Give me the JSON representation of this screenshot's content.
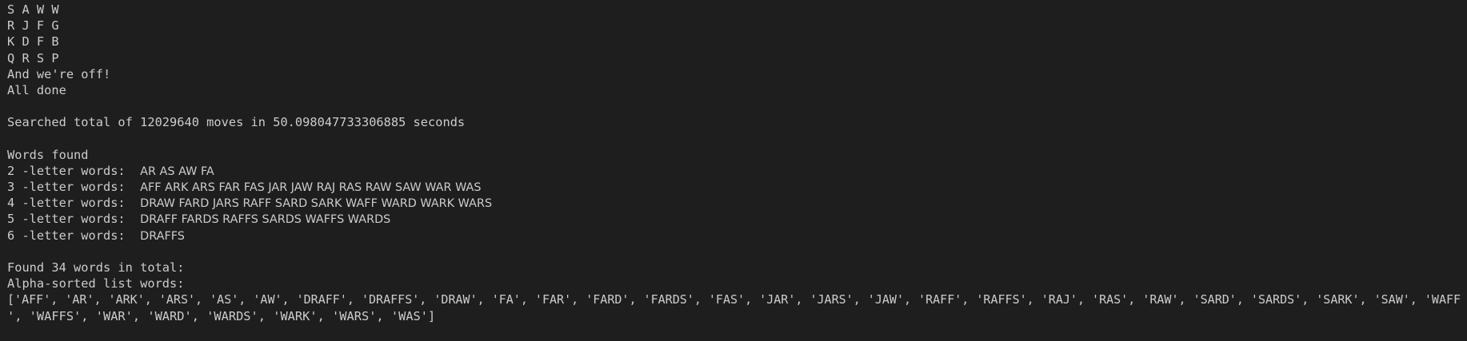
{
  "terminal": {
    "colors": {
      "background": "#1e1e1e",
      "text": "#cccccc"
    },
    "grid": [
      "S A W W",
      "R J F G",
      "K D F B",
      "Q R S P"
    ],
    "start_message": "And we're off!",
    "done_message": "All done",
    "summary": "Searched total of 12029640 moves in 50.098047733306885 seconds",
    "words_found_heading": "Words found",
    "word_groups": [
      {
        "label": "2 -letter words:  ",
        "words": "AR AS AW FA"
      },
      {
        "label": "3 -letter words:  ",
        "words": "AFF ARK ARS FAR FAS JAR JAW RAJ RAS RAW SAW WAR WAS"
      },
      {
        "label": "4 -letter words:  ",
        "words": "DRAW FARD JARS RAFF SARD SARK WAFF WARD WARK WARS"
      },
      {
        "label": "5 -letter words:  ",
        "words": "DRAFF FARDS RAFFS SARDS WAFFS WARDS"
      },
      {
        "label": "6 -letter words:  ",
        "words": "DRAFFS"
      }
    ],
    "total_found": "Found 34 words in total:",
    "sorted_heading": "Alpha-sorted list words:",
    "sorted_list_line1": "['AFF', 'AR', 'ARK', 'ARS', 'AS', 'AW', 'DRAFF', 'DRAFFS', 'DRAW', 'FA', 'FAR', 'FARD', 'FARDS', 'FAS', 'JAR', 'JARS', 'JAW', 'RAFF', 'RAFFS', 'RAJ', 'RAS', 'RAW', 'SARD', 'SARDS', 'SARK', 'SAW', 'WAFF",
    "sorted_list_line2": "', 'WAFFS', 'WAR', 'WARD', 'WARDS', 'WARK', 'WARS', 'WAS']"
  }
}
